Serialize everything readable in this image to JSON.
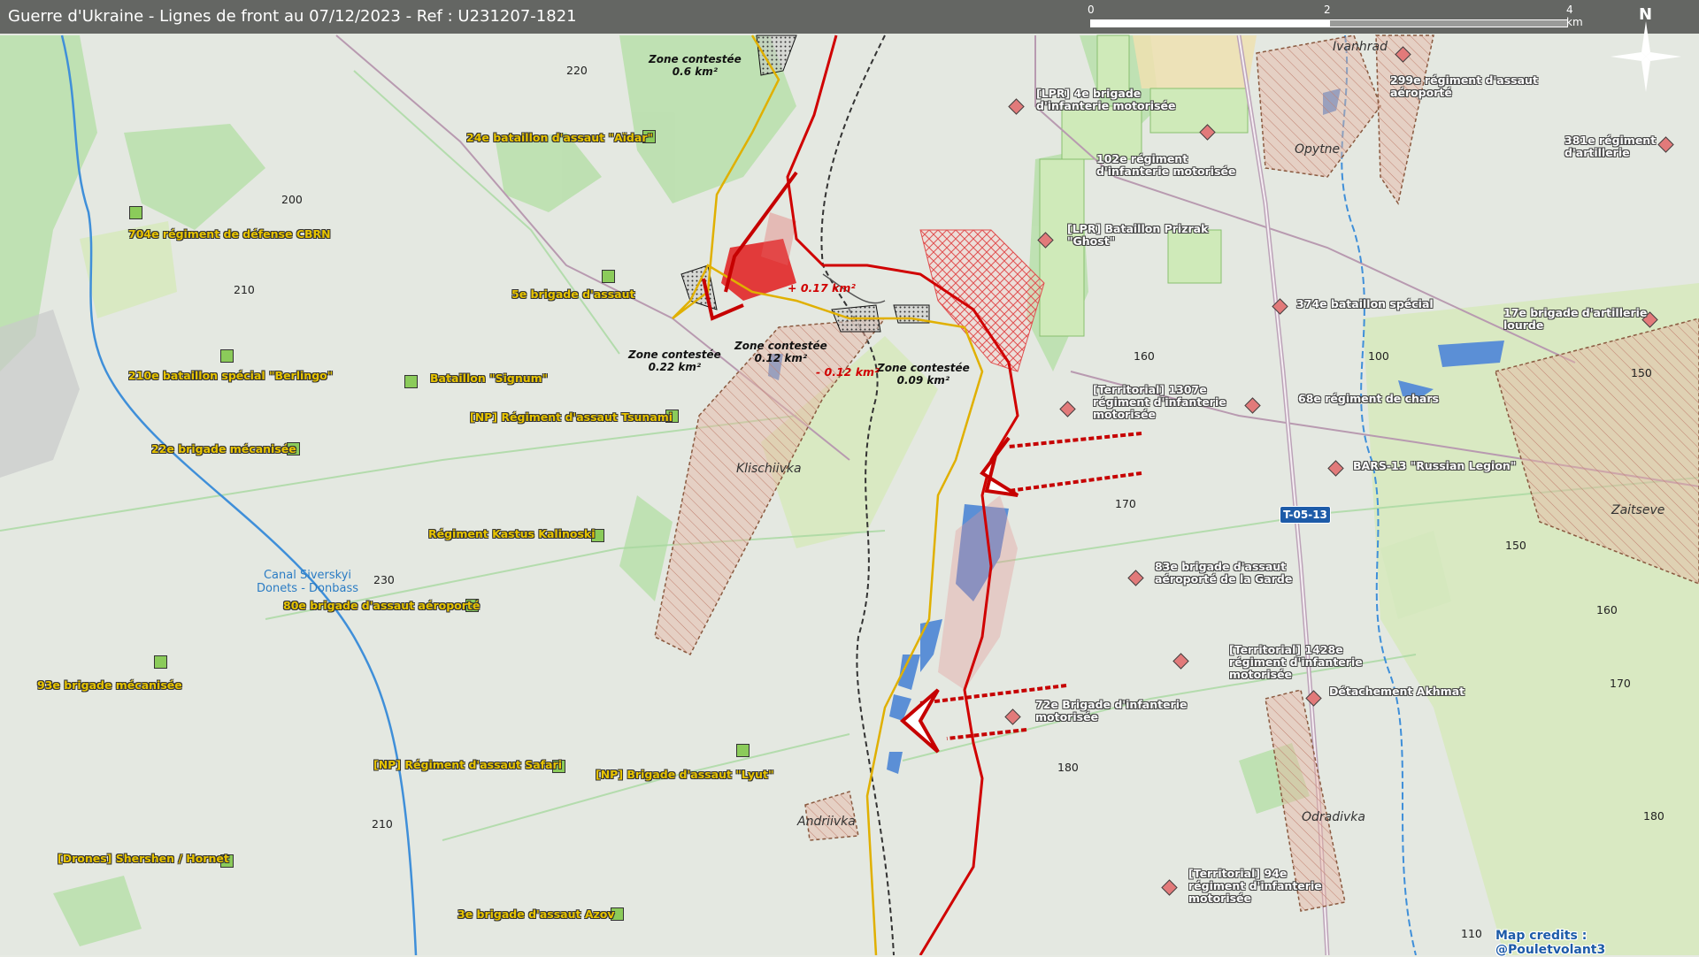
{
  "header": {
    "title": "Guerre d'Ukraine - Lignes de front au 07/12/2023 - Ref : U231207-1821"
  },
  "scale_bar": {
    "tick_0": "0",
    "tick_2": "2",
    "tick_4": "4 km"
  },
  "compass": {
    "label": "N"
  },
  "road_badge": "T-05-13",
  "credits": "Map credits : @Pouletvolant3",
  "canal_label": "Canal Siverskyi\nDonets - Donbass",
  "towns": {
    "klischiivka": "Klischiivka",
    "andriivka": "Andriivka",
    "opytne": "Opytne",
    "odradivka": "Odradivka",
    "zaitseve": "Zaitseve",
    "ivanhrad": "Ivanhrad"
  },
  "zones": {
    "z1": "Zone contestée\n0.6 km²",
    "z2": "Zone contestée\n0.22 km²",
    "z3": "Zone contestée\n0.12 km²",
    "z4": "Zone contestée\n0.09 km²"
  },
  "changes": {
    "gain": "+ 0.17 km²",
    "loss": "- 0.12 km²"
  },
  "altitudes": [
    "220",
    "200",
    "210",
    "230",
    "210",
    "170",
    "160",
    "100",
    "150",
    "150",
    "160",
    "170",
    "180",
    "180",
    "110"
  ],
  "ua_units": {
    "u1": "24e bataillon d'assaut \"Aïdar\"",
    "u2": "704e régiment de défense CBRN",
    "u3": "5e brigade d'assaut",
    "u4": "210e bataillon spécial \"Berlingo\"",
    "u5": "Bataillon \"Signum\"",
    "u6": "[NP] Régiment d'assaut Tsunami",
    "u7": "22e brigade mécanisée",
    "u8": "Régiment Kastus Kalinoski",
    "u9": "80e brigade d'assaut aéroporté",
    "u10": "93e brigade mécanisée",
    "u11": "[NP] Régiment d'assaut Safari",
    "u12": "[NP] Brigade d'assaut \"Lyut\"",
    "u13": "[Drones] Shershen / Hornet",
    "u14": "3e brigade d'assaut Azov"
  },
  "ru_units": {
    "r1": "[LPR] 4e brigade\nd'infanterie motorisée",
    "r2": "102e régiment\nd'infanterie motorisée",
    "r3": "[LPR] Bataillon Prizrak\n\"Ghost\"",
    "r4": "299e régiment d'assaut\naéroporté",
    "r5": "381e régiment\nd'artillerie",
    "r6": "374e bataillon spécial",
    "r7": "17e brigade d'artillerie\nlourde",
    "r8": "[Territorial] 1307e\nrégiment d'infanterie\nmotorisée",
    "r9": "68e régiment de chars",
    "r10": "BARS-13 \"Russian Legion\"",
    "r11": "83e brigade d'assaut\naéroporté de la Garde",
    "r12": "[Territorial] 1428e\nrégiment d'infanterie\nmotorisée",
    "r13": "Détachement Akhmat",
    "r14": "72e Brigade d'infanterie\nmotorisée",
    "r15": "[Territorial] 94e\nrégiment d'infanterie\nmotorisée"
  },
  "colors": {
    "ua": "#e8c400",
    "ru_front": "#d00000",
    "water": "#5b8fd6",
    "forest": "#b5dca6"
  }
}
